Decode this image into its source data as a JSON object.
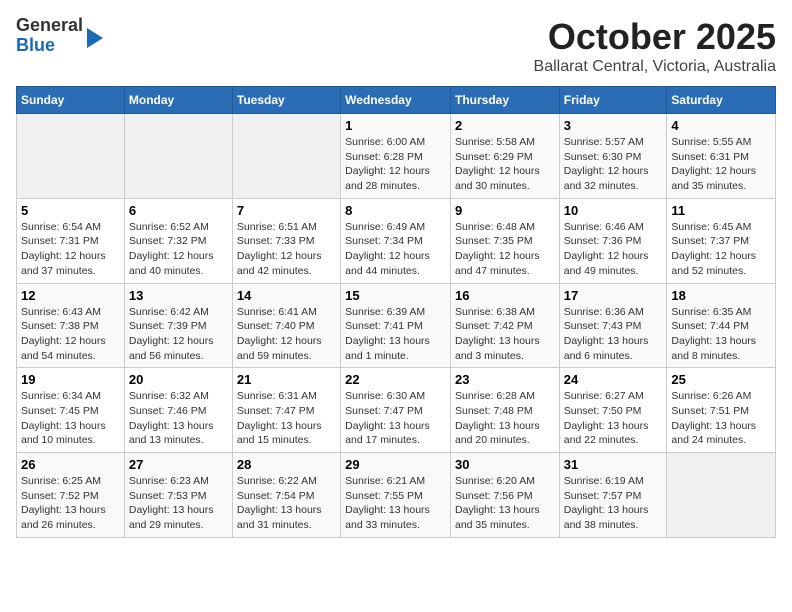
{
  "header": {
    "logo_general": "General",
    "logo_blue": "Blue",
    "title": "October 2025",
    "subtitle": "Ballarat Central, Victoria, Australia"
  },
  "days_of_week": [
    "Sunday",
    "Monday",
    "Tuesday",
    "Wednesday",
    "Thursday",
    "Friday",
    "Saturday"
  ],
  "weeks": [
    [
      {
        "day": "",
        "content": ""
      },
      {
        "day": "",
        "content": ""
      },
      {
        "day": "",
        "content": ""
      },
      {
        "day": "1",
        "content": "Sunrise: 6:00 AM\nSunset: 6:28 PM\nDaylight: 12 hours\nand 28 minutes."
      },
      {
        "day": "2",
        "content": "Sunrise: 5:58 AM\nSunset: 6:29 PM\nDaylight: 12 hours\nand 30 minutes."
      },
      {
        "day": "3",
        "content": "Sunrise: 5:57 AM\nSunset: 6:30 PM\nDaylight: 12 hours\nand 32 minutes."
      },
      {
        "day": "4",
        "content": "Sunrise: 5:55 AM\nSunset: 6:31 PM\nDaylight: 12 hours\nand 35 minutes."
      }
    ],
    [
      {
        "day": "5",
        "content": "Sunrise: 6:54 AM\nSunset: 7:31 PM\nDaylight: 12 hours\nand 37 minutes."
      },
      {
        "day": "6",
        "content": "Sunrise: 6:52 AM\nSunset: 7:32 PM\nDaylight: 12 hours\nand 40 minutes."
      },
      {
        "day": "7",
        "content": "Sunrise: 6:51 AM\nSunset: 7:33 PM\nDaylight: 12 hours\nand 42 minutes."
      },
      {
        "day": "8",
        "content": "Sunrise: 6:49 AM\nSunset: 7:34 PM\nDaylight: 12 hours\nand 44 minutes."
      },
      {
        "day": "9",
        "content": "Sunrise: 6:48 AM\nSunset: 7:35 PM\nDaylight: 12 hours\nand 47 minutes."
      },
      {
        "day": "10",
        "content": "Sunrise: 6:46 AM\nSunset: 7:36 PM\nDaylight: 12 hours\nand 49 minutes."
      },
      {
        "day": "11",
        "content": "Sunrise: 6:45 AM\nSunset: 7:37 PM\nDaylight: 12 hours\nand 52 minutes."
      }
    ],
    [
      {
        "day": "12",
        "content": "Sunrise: 6:43 AM\nSunset: 7:38 PM\nDaylight: 12 hours\nand 54 minutes."
      },
      {
        "day": "13",
        "content": "Sunrise: 6:42 AM\nSunset: 7:39 PM\nDaylight: 12 hours\nand 56 minutes."
      },
      {
        "day": "14",
        "content": "Sunrise: 6:41 AM\nSunset: 7:40 PM\nDaylight: 12 hours\nand 59 minutes."
      },
      {
        "day": "15",
        "content": "Sunrise: 6:39 AM\nSunset: 7:41 PM\nDaylight: 13 hours\nand 1 minute."
      },
      {
        "day": "16",
        "content": "Sunrise: 6:38 AM\nSunset: 7:42 PM\nDaylight: 13 hours\nand 3 minutes."
      },
      {
        "day": "17",
        "content": "Sunrise: 6:36 AM\nSunset: 7:43 PM\nDaylight: 13 hours\nand 6 minutes."
      },
      {
        "day": "18",
        "content": "Sunrise: 6:35 AM\nSunset: 7:44 PM\nDaylight: 13 hours\nand 8 minutes."
      }
    ],
    [
      {
        "day": "19",
        "content": "Sunrise: 6:34 AM\nSunset: 7:45 PM\nDaylight: 13 hours\nand 10 minutes."
      },
      {
        "day": "20",
        "content": "Sunrise: 6:32 AM\nSunset: 7:46 PM\nDaylight: 13 hours\nand 13 minutes."
      },
      {
        "day": "21",
        "content": "Sunrise: 6:31 AM\nSunset: 7:47 PM\nDaylight: 13 hours\nand 15 minutes."
      },
      {
        "day": "22",
        "content": "Sunrise: 6:30 AM\nSunset: 7:47 PM\nDaylight: 13 hours\nand 17 minutes."
      },
      {
        "day": "23",
        "content": "Sunrise: 6:28 AM\nSunset: 7:48 PM\nDaylight: 13 hours\nand 20 minutes."
      },
      {
        "day": "24",
        "content": "Sunrise: 6:27 AM\nSunset: 7:50 PM\nDaylight: 13 hours\nand 22 minutes."
      },
      {
        "day": "25",
        "content": "Sunrise: 6:26 AM\nSunset: 7:51 PM\nDaylight: 13 hours\nand 24 minutes."
      }
    ],
    [
      {
        "day": "26",
        "content": "Sunrise: 6:25 AM\nSunset: 7:52 PM\nDaylight: 13 hours\nand 26 minutes."
      },
      {
        "day": "27",
        "content": "Sunrise: 6:23 AM\nSunset: 7:53 PM\nDaylight: 13 hours\nand 29 minutes."
      },
      {
        "day": "28",
        "content": "Sunrise: 6:22 AM\nSunset: 7:54 PM\nDaylight: 13 hours\nand 31 minutes."
      },
      {
        "day": "29",
        "content": "Sunrise: 6:21 AM\nSunset: 7:55 PM\nDaylight: 13 hours\nand 33 minutes."
      },
      {
        "day": "30",
        "content": "Sunrise: 6:20 AM\nSunset: 7:56 PM\nDaylight: 13 hours\nand 35 minutes."
      },
      {
        "day": "31",
        "content": "Sunrise: 6:19 AM\nSunset: 7:57 PM\nDaylight: 13 hours\nand 38 minutes."
      },
      {
        "day": "",
        "content": ""
      }
    ]
  ]
}
